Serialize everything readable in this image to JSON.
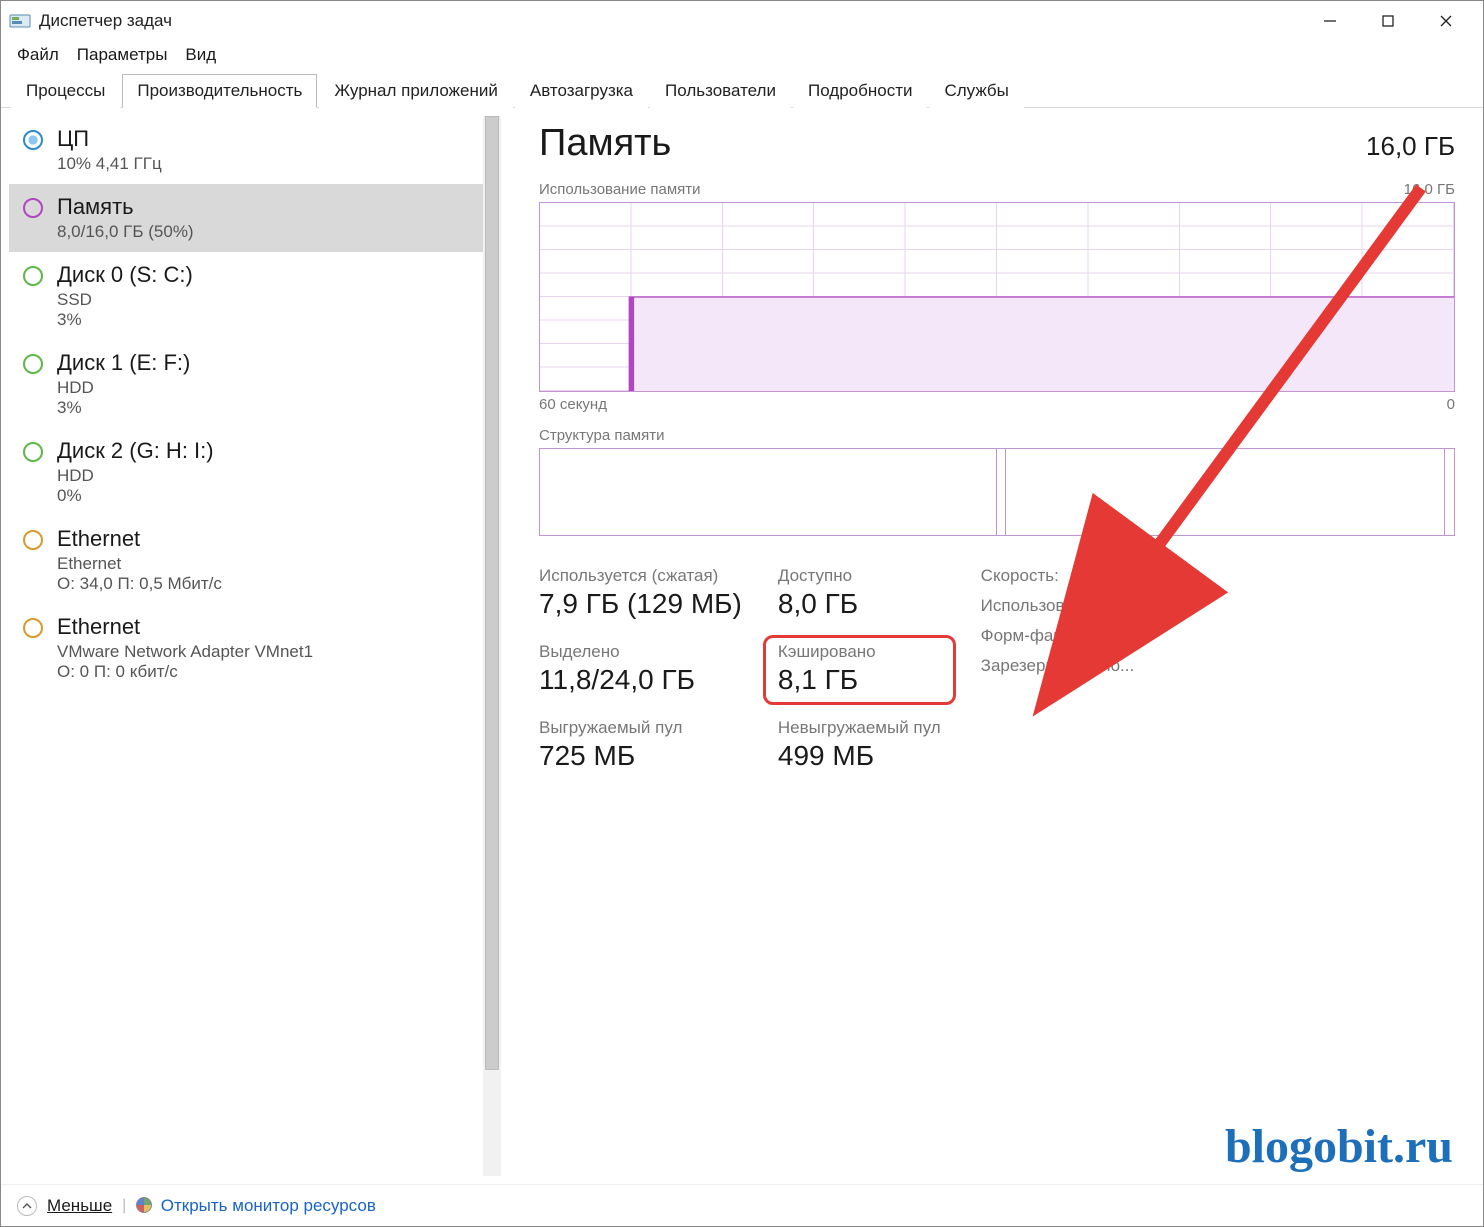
{
  "window_title": "Диспетчер задач",
  "menu": {
    "file": "Файл",
    "options": "Параметры",
    "view": "Вид"
  },
  "tabs": {
    "processes": "Процессы",
    "performance": "Производительность",
    "app_history": "Журнал приложений",
    "startup": "Автозагрузка",
    "users": "Пользователи",
    "details": "Подробности",
    "services": "Службы"
  },
  "sidebar": [
    {
      "id": "cpu",
      "title": "ЦП",
      "sub1": "10% 4,41 ГГц",
      "sub2": ""
    },
    {
      "id": "mem",
      "title": "Память",
      "sub1": "8,0/16,0 ГБ (50%)",
      "sub2": ""
    },
    {
      "id": "disk0",
      "title": "Диск 0 (S: C:)",
      "sub1": "SSD",
      "sub2": "3%"
    },
    {
      "id": "disk1",
      "title": "Диск 1 (E: F:)",
      "sub1": "HDD",
      "sub2": "3%"
    },
    {
      "id": "disk2",
      "title": "Диск 2 (G: H: I:)",
      "sub1": "HDD",
      "sub2": "0%"
    },
    {
      "id": "net0",
      "title": "Ethernet",
      "sub1": "Ethernet",
      "sub2": "О: 34,0 П: 0,5 Мбит/с"
    },
    {
      "id": "net1",
      "title": "Ethernet",
      "sub1": "VMware Network Adapter VMnet1",
      "sub2": "О: 0 П: 0 кбит/с"
    }
  ],
  "footer": {
    "less": "Меньше",
    "open_resmon": "Открыть монитор ресурсов"
  },
  "detail": {
    "title": "Память",
    "capacity": "16,0 ГБ",
    "usage_label": "Использование памяти",
    "usage_max": "16,0 ГБ",
    "time_axis_left": "60 секунд",
    "time_axis_right": "0",
    "composition_label": "Структура памяти",
    "stats": {
      "in_use_label": "Используется (сжатая)",
      "in_use_value": "7,9 ГБ (129 МБ)",
      "available_label": "Доступно",
      "available_value": "8,0 ГБ",
      "committed_label": "Выделено",
      "committed_value": "11,8/24,0 ГБ",
      "cached_label": "Кэшировано",
      "cached_value": "8,1 ГБ",
      "paged_label": "Выгружаемый пул",
      "paged_value": "725 МБ",
      "nonpaged_label": "Невыгружаемый пул",
      "nonpaged_value": "499 МБ"
    },
    "meta": {
      "speed_label": "Скорость:",
      "slots_label": "Использовано гн...",
      "form_label": "Форм-фактор:",
      "reserved_label": "Зарезервировано..."
    }
  },
  "watermark": "blogobit.ru",
  "colors": {
    "memory_accent": "#b146c2",
    "highlight_red": "#e53935"
  },
  "chart_data": {
    "type": "line",
    "title": "Использование памяти",
    "xlabel_left": "60 секунд",
    "xlabel_right": "0",
    "ylabel_max": "16,0 ГБ",
    "ylim": [
      0,
      16
    ],
    "x_seconds": [
      60,
      55,
      50,
      45,
      40,
      35,
      30,
      25,
      20,
      15,
      10,
      5,
      0
    ],
    "values_GB": [
      null,
      null,
      8.0,
      8.0,
      8.0,
      8.0,
      8.0,
      8.0,
      8.0,
      8.0,
      8.0,
      8.0,
      8.0
    ]
  },
  "composition_data": {
    "segments_percent": [
      50,
      1,
      48,
      1
    ]
  }
}
